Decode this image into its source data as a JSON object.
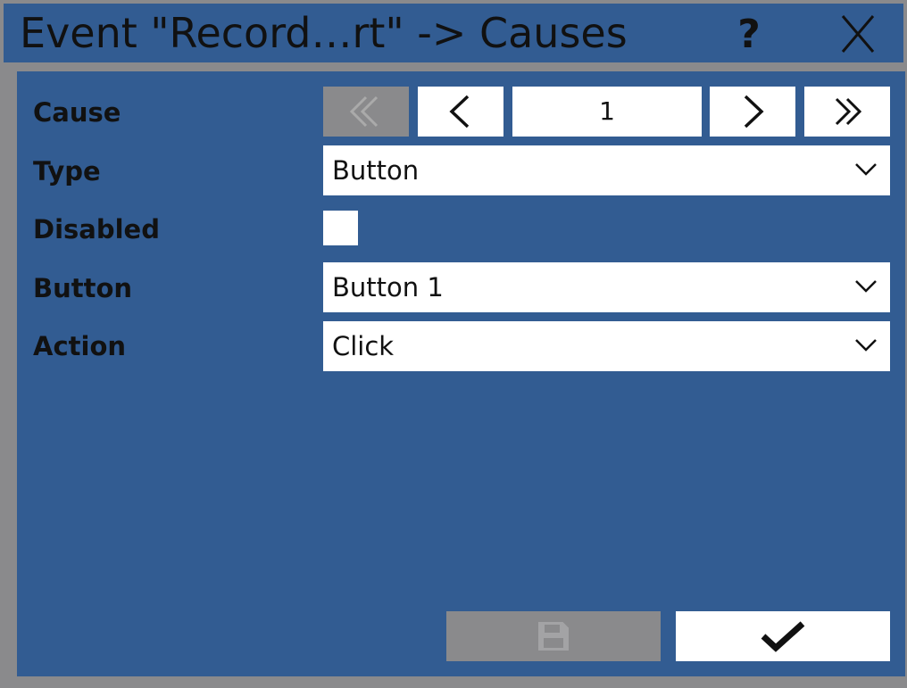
{
  "window": {
    "title": "Event \"Record…rt\" -> Causes",
    "help_label": "?",
    "close_icon": "close-icon"
  },
  "colors": {
    "panel": "#325c92",
    "frame": "#8a8a8c",
    "field": "#ffffff",
    "text": "#111111"
  },
  "form": {
    "cause": {
      "label": "Cause",
      "page_value": "1",
      "first_icon": "double-chevron-left-icon",
      "prev_icon": "chevron-left-icon",
      "next_icon": "chevron-right-icon",
      "last_icon": "double-chevron-right-icon",
      "first_enabled": false
    },
    "type": {
      "label": "Type",
      "value": "Button"
    },
    "disabled": {
      "label": "Disabled",
      "checked": false
    },
    "button": {
      "label": "Button",
      "value": "Button 1"
    },
    "action": {
      "label": "Action",
      "value": "Click"
    }
  },
  "footer": {
    "save_icon": "save-icon",
    "save_enabled": false,
    "ok_icon": "checkmark-icon"
  }
}
